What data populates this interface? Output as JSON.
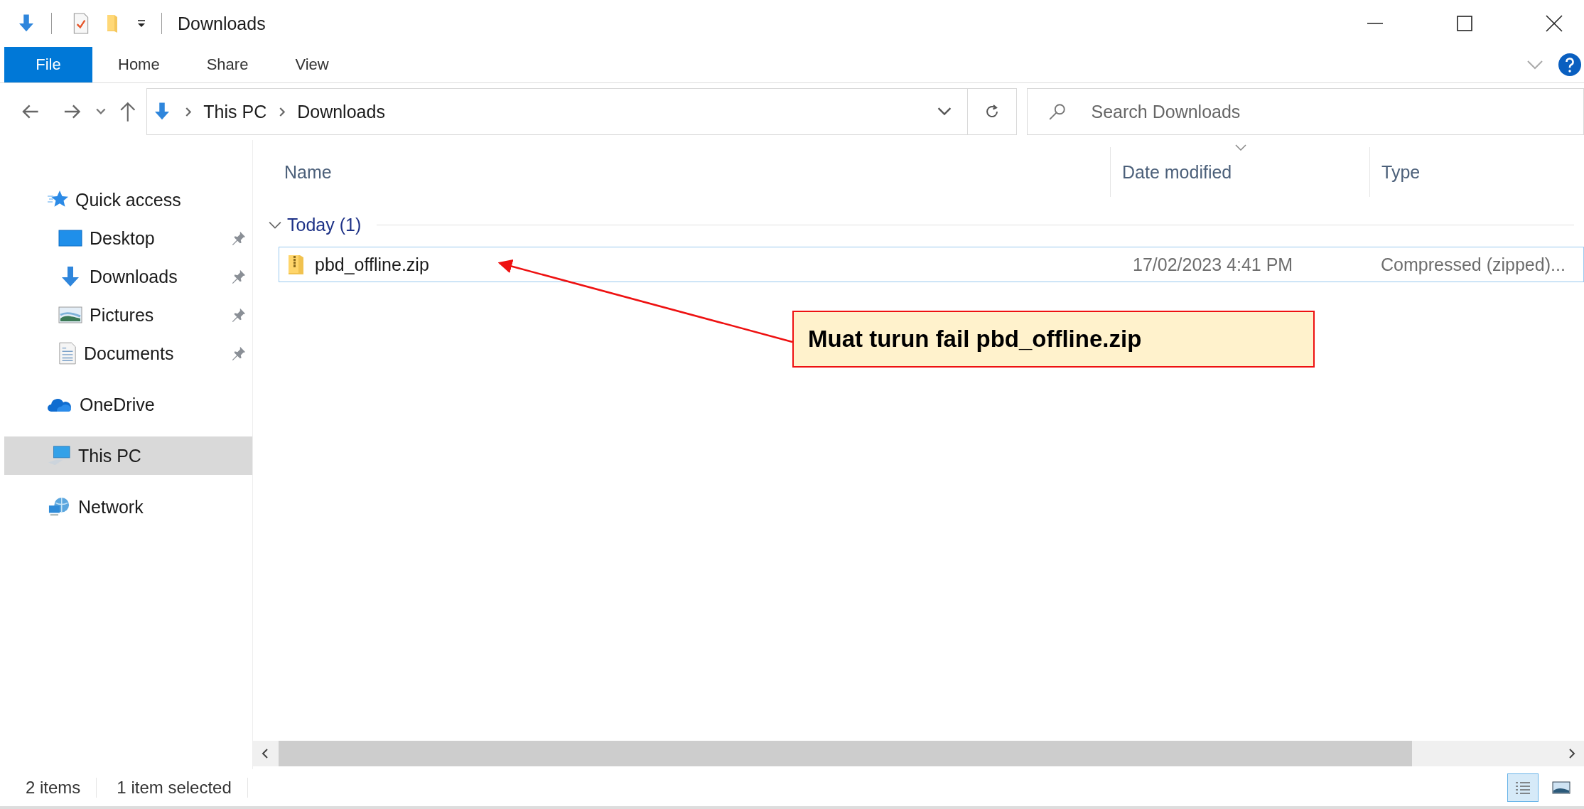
{
  "title_bar": {
    "title": "Downloads"
  },
  "ribbon": {
    "tabs": [
      {
        "label": "File",
        "selected": true
      },
      {
        "label": "Home",
        "selected": false
      },
      {
        "label": "Share",
        "selected": false
      },
      {
        "label": "View",
        "selected": false
      }
    ]
  },
  "address_bar": {
    "path": [
      "This PC",
      "Downloads"
    ]
  },
  "search": {
    "placeholder": "Search Downloads"
  },
  "sidebar": {
    "items": [
      {
        "label": "Quick access",
        "kind": "quick",
        "selected": false,
        "children": [
          {
            "label": "Desktop",
            "kind": "desktop",
            "pinned": true,
            "selected": false
          },
          {
            "label": "Downloads",
            "kind": "downloads",
            "pinned": true,
            "selected": false
          },
          {
            "label": "Pictures",
            "kind": "pictures",
            "pinned": true,
            "selected": false
          },
          {
            "label": "Documents",
            "kind": "documents",
            "pinned": true,
            "selected": false
          }
        ]
      },
      {
        "label": "OneDrive",
        "kind": "onedrive",
        "selected": false
      },
      {
        "label": "This PC",
        "kind": "pc",
        "selected": true
      },
      {
        "label": "Network",
        "kind": "network",
        "selected": false
      }
    ]
  },
  "columns": [
    "Name",
    "Date modified",
    "Type"
  ],
  "groups": [
    {
      "label": "Today (1)",
      "expanded": true,
      "files": [
        {
          "name": "pbd_offline.zip",
          "date": "17/02/2023 4:41 PM",
          "type": "Compressed (zipped)...",
          "selected": true
        }
      ]
    }
  ],
  "annotation": {
    "text": "Muat turun fail pbd_offline.zip"
  },
  "status_bar": {
    "item_count": "2 items",
    "selection": "1 item selected"
  }
}
